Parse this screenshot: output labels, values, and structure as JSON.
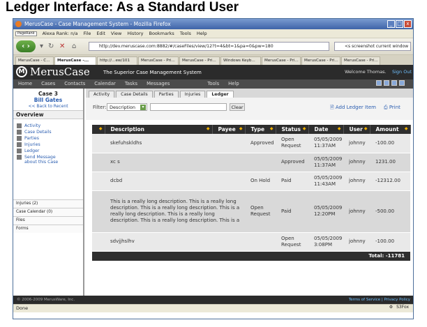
{
  "heading": "Ledger Interface: As a Standard User",
  "window": {
    "title": "MerusCase - Case Management System - Mozilla Firefox"
  },
  "menu": {
    "pagerank": "PageRank",
    "alexa": "Alexa Rank: n/a",
    "items": [
      "File",
      "Edit",
      "View",
      "History",
      "Bookmarks",
      "Tools",
      "Help"
    ]
  },
  "nav": {
    "url": "http://dev.meruscase.com:8882/#/caseFiles/view/12?t=4&bt=1&pa=0&pw=180",
    "search": "<s screenshot current window"
  },
  "browser_tabs": [
    "MerusCase - C...",
    "MerusCase -...",
    "http://...ew/101",
    "MerusCase - Pri...",
    "MerusCase - Pri...",
    "Windows Keyb...",
    "MerusCase - Pri...",
    "MerusCase - Pri...",
    "MerusCase - Pri...",
    "MerusCase - Pri..."
  ],
  "app": {
    "logo": "M",
    "brand": "MerusCase",
    "tagline": "The Superior Case Management System",
    "welcome": "Welcome Thomas.",
    "signout": "Sign Out"
  },
  "appnav": [
    "Home",
    "Cases",
    "Contacts",
    "Calendar",
    "Tasks",
    "Messages",
    "Tools",
    "Help"
  ],
  "sidebar": {
    "case": "Case 3",
    "client": "Bill Gates",
    "back": "<< Back to Recent",
    "overview": "Overview",
    "items": [
      "Activity",
      "Case Details",
      "Parties",
      "Injuries",
      "Ledger",
      "Send Message about this Case"
    ],
    "sections": [
      "Injuries (2)",
      "Case Calendar (0)",
      "Files",
      "Forms"
    ]
  },
  "content_tabs": [
    "Activity",
    "Case Details",
    "Parties",
    "Injuries",
    "Ledger"
  ],
  "filter": {
    "label": "Filter:",
    "field": "Description",
    "clear": "Clear",
    "add": "Add Ledger Item",
    "print": "Print"
  },
  "table": {
    "headers": [
      "Description",
      "Payee",
      "Type",
      "Status",
      "Date",
      "User",
      "Amount"
    ],
    "rows": [
      {
        "desc": "skefuhskldhs",
        "payee": "",
        "type": "Approved",
        "status": "Open Request",
        "date": "05/05/2009 11:37AM",
        "user": "johnny",
        "amount": "-100.00"
      },
      {
        "desc": "xc s",
        "payee": "",
        "type": "",
        "status": "Approved",
        "date": "05/05/2009 11:37AM",
        "user": "johnny",
        "amount": "1231.00"
      },
      {
        "desc": "dcbd",
        "payee": "",
        "type": "On Hold",
        "status": "Paid",
        "date": "05/05/2009 11:43AM",
        "user": "johnny",
        "amount": "-12312.00"
      },
      {
        "desc": "This is a really long description. This is a really long description. This is a really long description. This is a really long description. This is a really long description. This is a really long description. This is a",
        "payee": "",
        "type": "Open Request",
        "status": "Paid",
        "date": "05/05/2009 12:20PM",
        "user": "johnny",
        "amount": "-500.00"
      },
      {
        "desc": "sdvjjhslhv",
        "payee": "",
        "type": "",
        "status": "Open Request",
        "date": "05/05/2009 3:08PM",
        "user": "johnny",
        "amount": "-100.00"
      }
    ],
    "total_label": "Total:",
    "total": "-11781"
  },
  "footer": {
    "left": "© 2006-2009 MerusWare, Inc.",
    "right": "Terms of Service | Privacy Policy"
  },
  "statusbar": {
    "text": "Done",
    "right": "S3Fox"
  },
  "colors": {
    "appbar": "#2b2b2b",
    "link": "#2a5db0",
    "header": "#2e2e2e"
  }
}
